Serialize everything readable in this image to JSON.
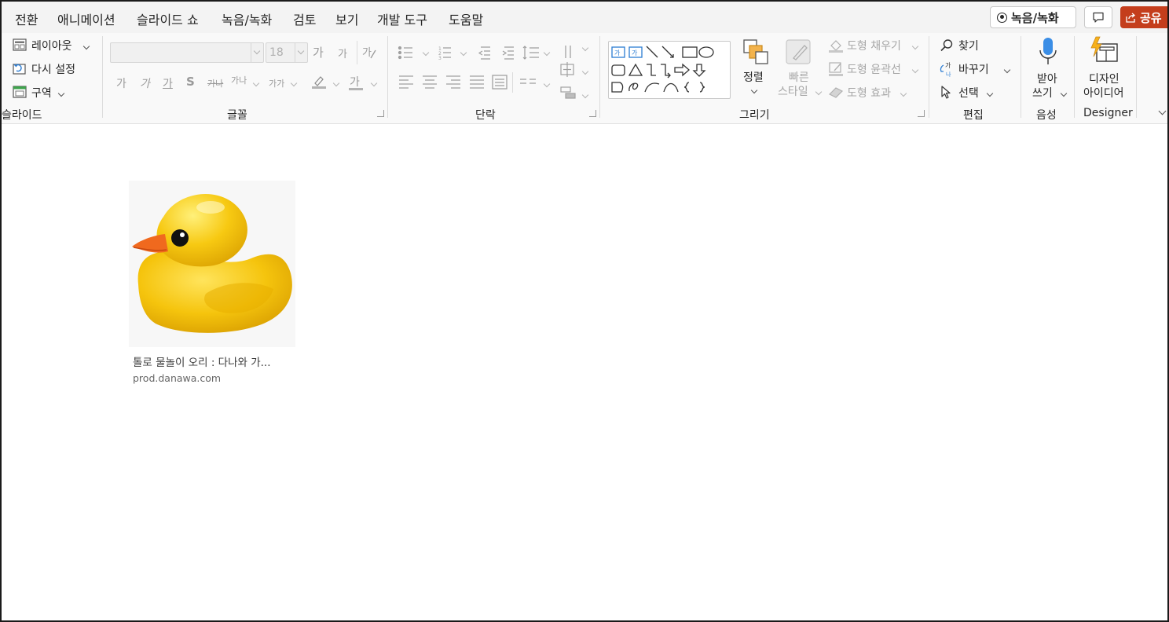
{
  "menu": {
    "tabs": [
      "전환",
      "애니메이션",
      "슬라이드 쇼",
      "녹음/녹화",
      "검토",
      "보기",
      "개발 도구",
      "도움말"
    ],
    "record_label": "녹음/녹화",
    "share_label": "공유"
  },
  "ribbon": {
    "slides": {
      "layout": "레이아웃",
      "reset": "다시 설정",
      "section": "구역",
      "group_label": "슬라이드"
    },
    "font": {
      "size_value": "18",
      "group_label": "글꼴",
      "glyphs": [
        "가",
        "가",
        "가",
        "S",
        "가나",
        "가나",
        "가가",
        "가"
      ],
      "grow": "가",
      "shrink": "가"
    },
    "paragraph": {
      "group_label": "단락"
    },
    "drawing": {
      "arrange": "정렬",
      "quick_styles_1": "빠른",
      "quick_styles_2": "스타일",
      "shape_fill": "도형 채우기",
      "shape_outline": "도형 윤곽선",
      "shape_effects": "도형 효과",
      "group_label": "그리기",
      "textbox_glyph": "가"
    },
    "editing": {
      "find": "찾기",
      "replace": "바꾸기",
      "select": "선택",
      "group_label": "편집"
    },
    "voice": {
      "dictate_1": "받아",
      "dictate_2": "쓰기",
      "group_label": "음성"
    },
    "designer": {
      "ideas_1": "디자인",
      "ideas_2": "아이디어",
      "group_label": "Designer"
    }
  },
  "result": {
    "title": "톨로 물놀이 오리 : 다나와 가...",
    "source": "prod.danawa.com",
    "image_icon": "rubber-duck"
  },
  "colors": {
    "share": "#c43e1c",
    "duck_yellow": "#f5c40d",
    "beak_orange": "#f0691e",
    "dictate_blue": "#3b8ee6"
  }
}
